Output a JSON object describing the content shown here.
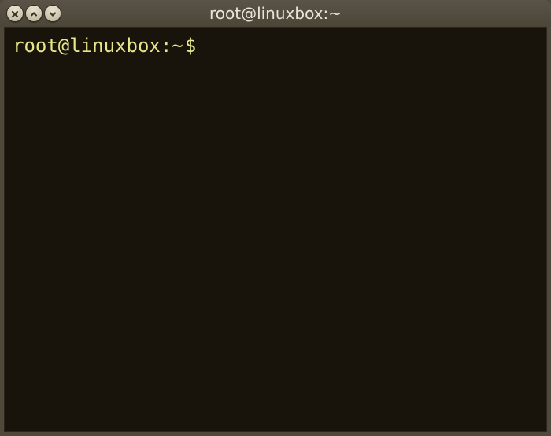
{
  "titlebar": {
    "title": "root@linuxbox:~",
    "controls": {
      "close": "close",
      "maximize": "maximize",
      "minimize": "minimize"
    }
  },
  "terminal": {
    "prompt": "root@linuxbox:~",
    "prompt_symbol": "$",
    "command": ""
  },
  "colors": {
    "window_frame": "#50493b",
    "terminal_bg": "#18140c",
    "prompt_color": "#e6e68a",
    "title_color": "#e8e4d8"
  }
}
